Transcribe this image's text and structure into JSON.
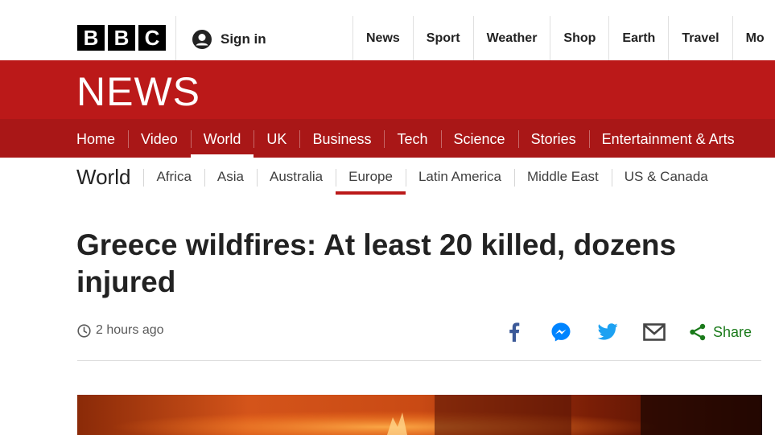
{
  "brand": {
    "logo_letters": [
      "B",
      "B",
      "C"
    ],
    "section_name": "NEWS",
    "colors": {
      "brand_red": "#bb1919",
      "nav_red": "#a91717",
      "share_green": "#1a7a1a",
      "facebook_blue": "#3b5998",
      "twitter_blue": "#1da1f2",
      "messenger_blue": "#0084ff"
    }
  },
  "account": {
    "signin_label": "Sign in",
    "icon": "user-icon"
  },
  "global_nav": {
    "items": [
      "News",
      "Sport",
      "Weather",
      "Shop",
      "Earth",
      "Travel",
      "Mo"
    ]
  },
  "section_nav": {
    "items": [
      "Home",
      "Video",
      "World",
      "UK",
      "Business",
      "Tech",
      "Science",
      "Stories",
      "Entertainment & Arts"
    ],
    "active": "World"
  },
  "sub_nav": {
    "title": "World",
    "items": [
      "Africa",
      "Asia",
      "Australia",
      "Europe",
      "Latin America",
      "Middle East",
      "US & Canada"
    ],
    "active": "Europe"
  },
  "article": {
    "headline": "Greece wildfires: At least 20 killed, dozens injured",
    "timestamp": "2 hours ago"
  },
  "share": {
    "icons": [
      "facebook-icon",
      "messenger-icon",
      "twitter-icon",
      "email-icon"
    ],
    "share_label": "Share"
  }
}
